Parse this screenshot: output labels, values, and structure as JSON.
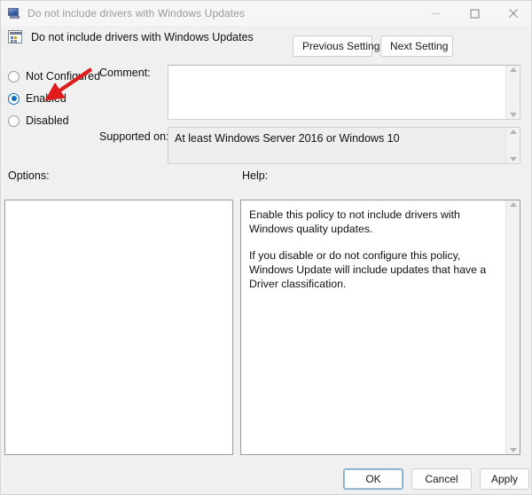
{
  "window": {
    "title": "Do not include drivers with Windows Updates",
    "icon": "computer-policy-icon",
    "controls": {
      "minimize": "–",
      "maximize": "□",
      "close": "✕"
    }
  },
  "header": {
    "policy_title": "Do not include drivers with Windows Updates",
    "icon": "group-policy-setting-icon",
    "previous_setting_label": "Previous Setting",
    "next_setting_label": "Next Setting"
  },
  "state": {
    "options": [
      {
        "id": "not-configured",
        "label": "Not Configured",
        "selected": false
      },
      {
        "id": "enabled",
        "label": "Enabled",
        "selected": true
      },
      {
        "id": "disabled",
        "label": "Disabled",
        "selected": false
      }
    ],
    "selected_value": "Enabled"
  },
  "comment": {
    "label": "Comment:",
    "value": "",
    "placeholder": ""
  },
  "supported": {
    "label": "Supported on:",
    "value": "At least Windows Server 2016 or Windows 10"
  },
  "panels": {
    "options_label": "Options:",
    "options_content": "",
    "help_label": "Help:",
    "help_paragraphs": [
      "Enable this policy to not include drivers with Windows quality updates.",
      "If you disable or do not configure this policy, Windows Update will include updates that have a Driver classification."
    ]
  },
  "footer": {
    "ok_label": "OK",
    "cancel_label": "Cancel",
    "apply_label": "Apply"
  },
  "annotation": {
    "type": "red-arrow",
    "color": "#e01b1b",
    "points_to": "Enabled"
  },
  "colors": {
    "accent": "#0f6cbd",
    "window_background": "#f0f0f0",
    "panel_background": "#ffffff",
    "annotation_red": "#e01b1b"
  }
}
